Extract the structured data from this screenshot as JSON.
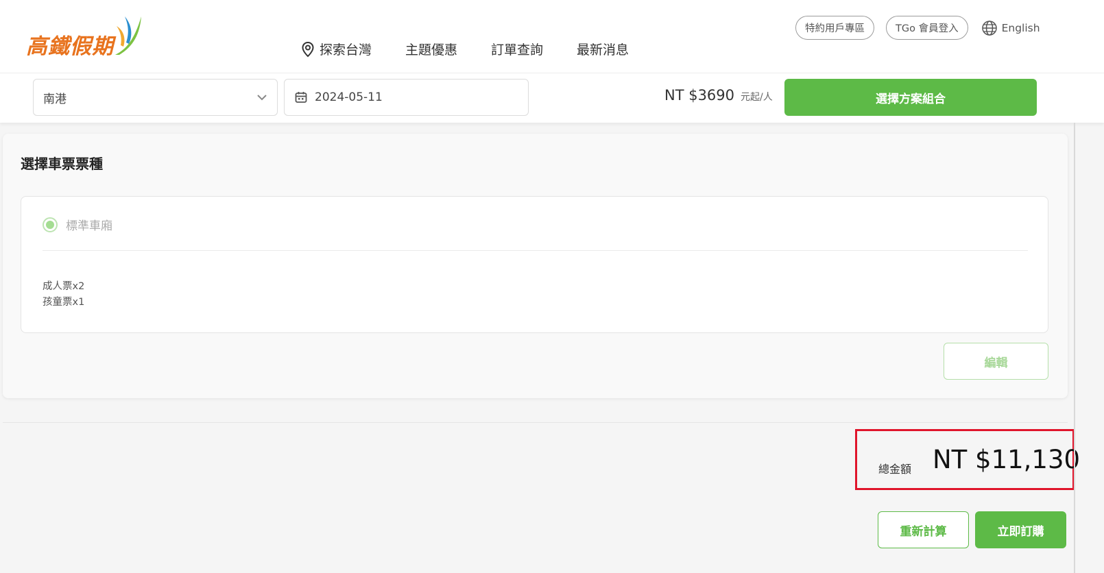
{
  "header": {
    "logo_text": "高鐵假期",
    "nav": [
      {
        "label": "探索台灣",
        "icon": "location-pin-icon"
      },
      {
        "label": "主題優惠"
      },
      {
        "label": "訂單查詢"
      },
      {
        "label": "最新消息"
      }
    ],
    "partner_zone": "特約用戶專區",
    "member_login": "TGo 會員登入",
    "language": "English"
  },
  "search": {
    "station": "南港",
    "date": "2024-05-11",
    "price_from": "NT $3690",
    "price_unit": "元起/人",
    "select_button": "選擇方案組合"
  },
  "ticket_section": {
    "title": "選擇車票票種",
    "car_class": "標準車廂",
    "car_class_selected": true,
    "tickets": [
      "成人票x2",
      "孩童票x1"
    ],
    "edit_button": "編輯"
  },
  "total": {
    "label": "總金額",
    "amount": "NT $11,130"
  },
  "actions": {
    "recalculate": "重新計算",
    "book_now": "立即訂購"
  },
  "colors": {
    "brand_green": "#5dba47",
    "logo_orange": "#e8731e",
    "highlight_red": "#e0152b"
  }
}
